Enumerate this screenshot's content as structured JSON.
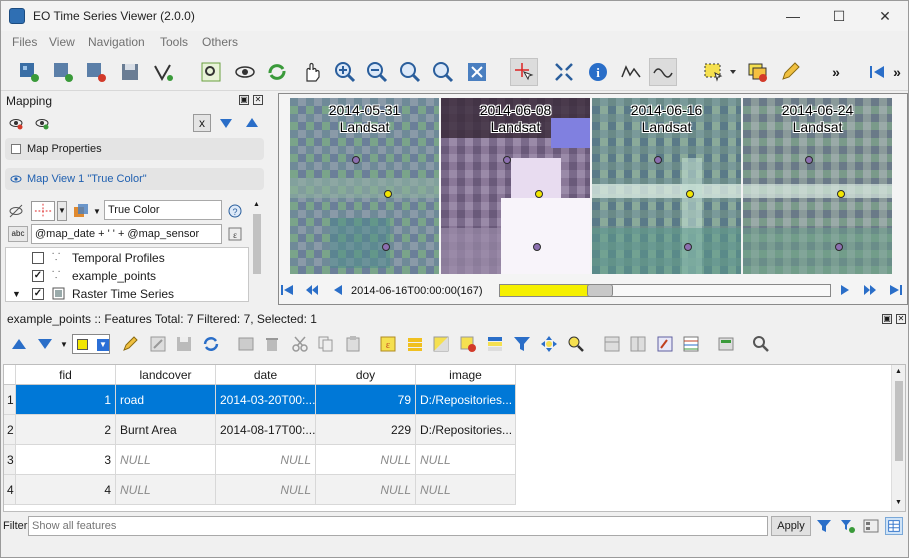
{
  "window": {
    "title": "EO Time Series Viewer (2.0.0)"
  },
  "menu": [
    "Files",
    "View",
    "Navigation",
    "Tools",
    "Others"
  ],
  "mapping": {
    "title": "Mapping",
    "clear_button": "x",
    "map_properties": "Map Properties",
    "map_view": "Map View 1 \"True Color\"",
    "style_name": "True Color",
    "expression": "@map_date + ' ' + @map_sensor",
    "abc_label": "abc",
    "layers": [
      {
        "name": "Temporal Profiles",
        "checked": false
      },
      {
        "name": "example_points",
        "checked": true
      },
      {
        "name": "Raster Time Series",
        "checked": true
      }
    ]
  },
  "map": {
    "tiles": [
      {
        "date": "2014-05-31",
        "sensor": "Landsat"
      },
      {
        "date": "2014-06-08",
        "sensor": "Landsat"
      },
      {
        "date": "2014-06-16",
        "sensor": "Landsat"
      },
      {
        "date": "2014-06-24",
        "sensor": "Landsat"
      }
    ],
    "current_date": "2014-06-16T00:00:00(167)",
    "progress": 0.27
  },
  "attribute_table": {
    "title": "example_points :: Features Total: 7 Filtered: 7, Selected: 1",
    "columns": [
      "fid",
      "landcover",
      "date",
      "doy",
      "image"
    ],
    "rows": [
      {
        "n": "1",
        "fid": "1",
        "landcover": "road",
        "date": "2014-03-20T00:...",
        "doy": "79",
        "image": "D:/Repositories...",
        "selected": true
      },
      {
        "n": "2",
        "fid": "2",
        "landcover": "Burnt Area",
        "date": "2014-08-17T00:...",
        "doy": "229",
        "image": "D:/Repositories...",
        "selected": false
      },
      {
        "n": "3",
        "fid": "3",
        "landcover": "NULL",
        "date": "NULL",
        "doy": "NULL",
        "image": "NULL",
        "selected": false
      },
      {
        "n": "4",
        "fid": "4",
        "landcover": "NULL",
        "date": "NULL",
        "doy": "NULL",
        "image": "NULL",
        "selected": false
      }
    ],
    "filter_label": "Filter",
    "filter_placeholder": "Show all features",
    "apply_label": "Apply"
  },
  "colors": {
    "accent": "#0078d7",
    "slider_fill": "#f5f000"
  }
}
